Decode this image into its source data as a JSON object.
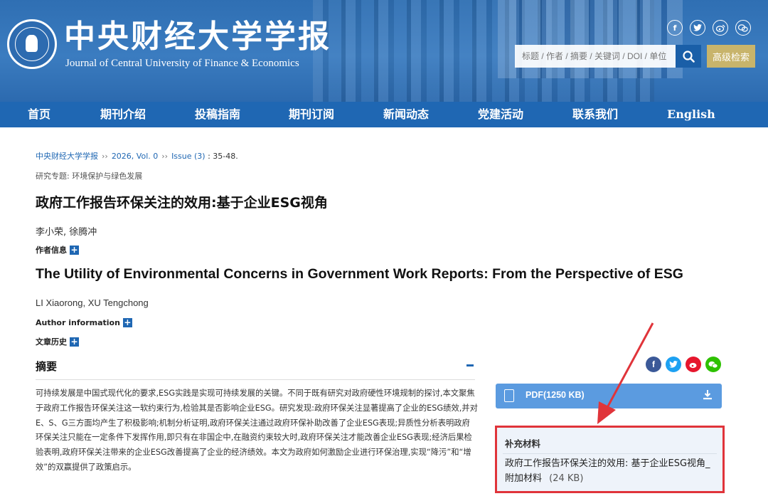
{
  "header": {
    "journal_title_cn": "中央财经大学学报",
    "journal_title_en": "Journal of Central University of Finance & Economics",
    "search": {
      "placeholder": "标题 / 作者 / 摘要 / 关键词 / DOI / 单位"
    },
    "advanced_search_label": "高级检索",
    "social_icons": [
      "facebook-icon",
      "twitter-icon",
      "weibo-icon",
      "wechat-icon"
    ]
  },
  "nav": {
    "items": [
      "首页",
      "期刊介绍",
      "投稿指南",
      "期刊订阅",
      "新闻动态",
      "党建活动",
      "联系我们",
      "English"
    ]
  },
  "breadcrumb": {
    "journal": "中央财经大学学报",
    "sep": "››",
    "volume": "2026, Vol. 0",
    "issue": "Issue (3)",
    "pages": " : 35-48."
  },
  "article": {
    "topic": "研究专题: 环境保护与绿色发展",
    "title_cn": "政府工作报告环保关注的效用:基于企业ESG视角",
    "authors_cn": "李小荣, 徐腾冲",
    "author_info_cn": "作者信息",
    "title_en": "The Utility of Environmental Concerns in Government Work Reports: From the Perspective of ESG",
    "authors_en": "LI Xiaorong, XU Tengchong",
    "author_info_en": "Author information",
    "history_label": "文章历史"
  },
  "abstract": {
    "heading": "摘要",
    "text": "可持续发展是中国式现代化的要求,ESG实践是实现可持续发展的关键。不同于既有研究对政府硬性环境规制的探讨,本文聚焦于政府工作报告环保关注这一软约束行为,检验其是否影响企业ESG。研究发现:政府环保关注显著提高了企业的ESG绩效,并对E、S、G三方面均产生了积极影响;机制分析证明,政府环保关注通过政府环保补助改善了企业ESG表现;异质性分析表明政府环保关注只能在一定条件下发挥作用,即只有在非国企中,在融资约束较大时,政府环保关注才能改善企业ESG表现;经济后果检验表明,政府环保关注带来的企业ESG改善提高了企业的经济绩效。本文为政府如何激励企业进行环保治理,实现“降污”和“增效”的双赢提供了政策启示。"
  },
  "sidebar": {
    "share_icons": [
      "facebook-icon",
      "twitter-icon",
      "weibo-icon",
      "wechat-icon"
    ],
    "pdf_label": "PDF(1250 KB)",
    "supplement": {
      "title": "补充材料",
      "file_name": "政府工作报告环保关注的效用: 基于企业ESG视角_附加材料",
      "file_size": "(24 KB)"
    }
  },
  "colors": {
    "brand_blue": "#1f67b3",
    "pdf_button": "#5b9be0",
    "highlight_red": "#e0343a",
    "advanced_search": "#c8b46b"
  }
}
